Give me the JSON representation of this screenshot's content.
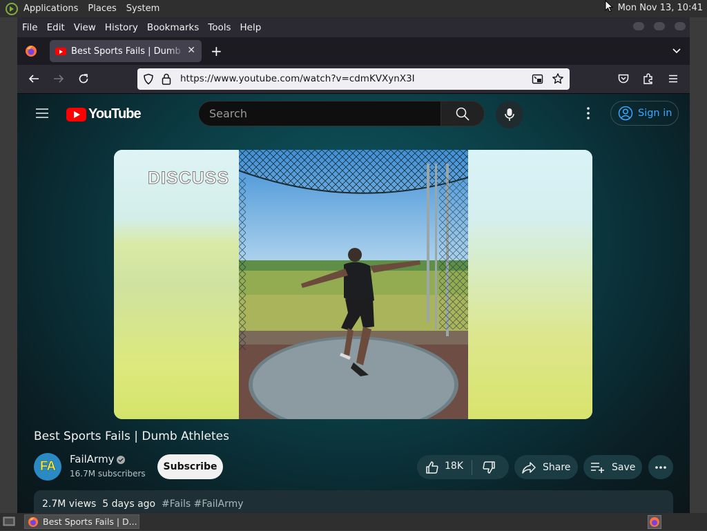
{
  "system_panel": {
    "menus": [
      "Applications",
      "Places",
      "System"
    ],
    "clock": "Mon Nov 13, 10:41"
  },
  "browser": {
    "menubar": [
      "File",
      "Edit",
      "View",
      "History",
      "Bookmarks",
      "Tools",
      "Help"
    ],
    "tab": {
      "title": "Best Sports Fails | Dumb Athletes",
      "close": "✕"
    },
    "new_tab": "+",
    "url": "https://www.youtube.com/watch?v=cdmKVXynX3I"
  },
  "youtube": {
    "logo_text": "YouTube",
    "search_placeholder": "Search",
    "sign_in": "Sign in",
    "video": {
      "overlay_text": "DISCUSS",
      "title": "Best Sports Fails | Dumb Athletes",
      "channel": "FailArmy",
      "channel_avatar": "FA",
      "subscribers": "16.7M subscribers",
      "subscribe": "Subscribe",
      "likes": "18K",
      "share": "Share",
      "save": "Save",
      "views": "2.7M views",
      "age": "5 days ago",
      "tags": "#Fails #FailArmy"
    }
  },
  "taskbar": {
    "window_item": "Best Sports Fails | D..."
  },
  "colors": {
    "youtube_red": "#ff0000",
    "sign_in_blue": "#3ea6ff",
    "page_bg": "#0b3b43"
  }
}
